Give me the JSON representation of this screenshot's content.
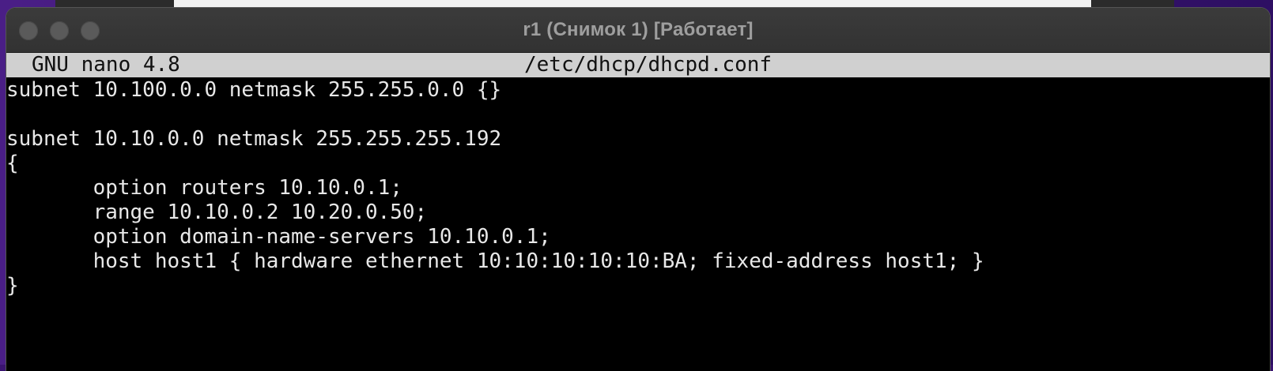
{
  "window": {
    "title": "r1 (Снимок 1) [Работает]"
  },
  "nano": {
    "version": "GNU nano 4.8",
    "filename": "/etc/dhcp/dhcpd.conf"
  },
  "editor": {
    "lines": [
      "subnet 10.100.0.0 netmask 255.255.0.0 {}",
      "",
      "subnet 10.10.0.0 netmask 255.255.255.192",
      "{",
      "       option routers 10.10.0.1;",
      "       range 10.10.0.2 10.20.0.50;",
      "       option domain-name-servers 10.10.0.1;",
      "       host host1 { hardware ethernet 10:10:10:10:10:BA; fixed-address host1; }",
      "}",
      "",
      ""
    ]
  }
}
